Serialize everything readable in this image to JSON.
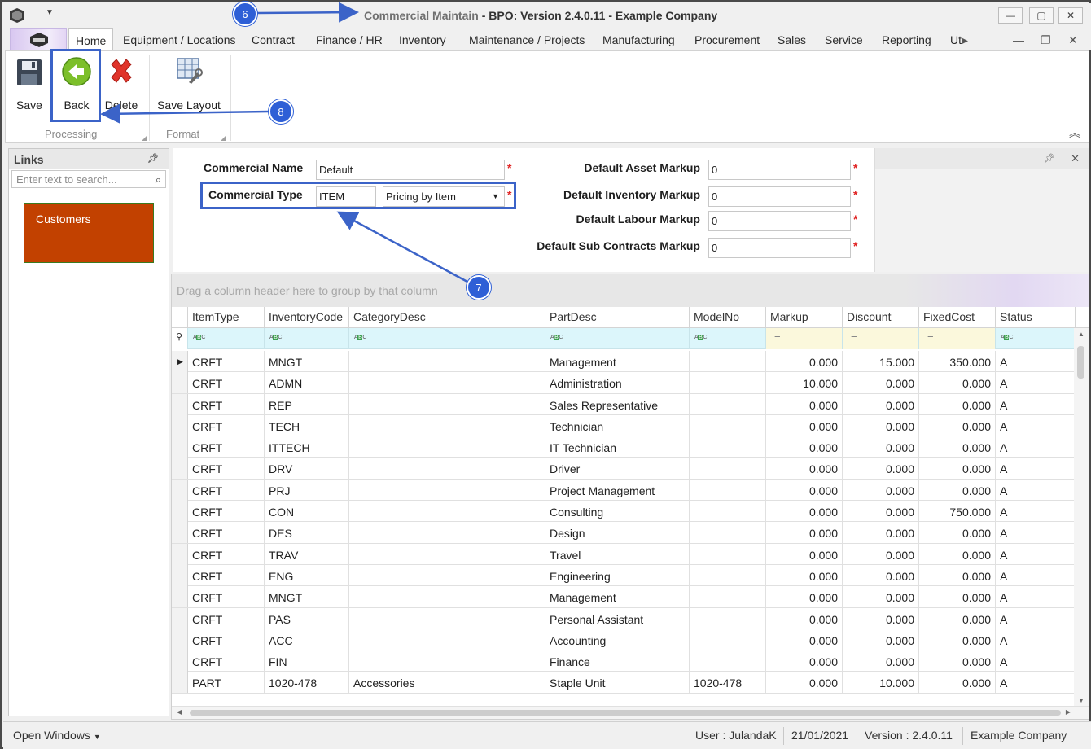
{
  "window": {
    "title_dim": "Commercial Maintain",
    "title_main": " - BPO: Version 2.4.0.11 - Example Company",
    "controls": [
      "—",
      "▢",
      "✕"
    ]
  },
  "ribbon_tabs": [
    "Home",
    "Equipment / Locations",
    "Contract",
    "Finance / HR",
    "Inventory",
    "Maintenance / Projects",
    "Manufacturing",
    "Procurement",
    "Sales",
    "Service",
    "Reporting",
    "Ut"
  ],
  "ribbon": {
    "buttons": {
      "save": "Save",
      "back": "Back",
      "delete": "Delete",
      "save_layout": "Save Layout"
    },
    "groups": {
      "processing": "Processing",
      "format": "Format"
    }
  },
  "links": {
    "title": "Links",
    "search_placeholder": "Enter text to search...",
    "tile": "Customers"
  },
  "form": {
    "commercial_name_label": "Commercial Name",
    "commercial_name_value": "Default",
    "commercial_type_label": "Commercial Type",
    "commercial_type_value": "ITEM",
    "commercial_type_select": "Pricing by Item",
    "asset_markup_label": "Default Asset Markup",
    "asset_markup_value": "0",
    "inventory_markup_label": "Default Inventory Markup",
    "inventory_markup_value": "0",
    "labour_markup_label": "Default Labour Markup",
    "labour_markup_value": "0",
    "subcontracts_markup_label": "Default Sub Contracts Markup",
    "subcontracts_markup_value": "0",
    "required_mark": "*"
  },
  "grid": {
    "group_hint": "Drag a column header here to group by that column",
    "columns": [
      "ItemType",
      "InventoryCode",
      "CategoryDesc",
      "PartDesc",
      "ModelNo",
      "Markup",
      "Discount",
      "FixedCost",
      "Status"
    ],
    "rows": [
      [
        "CRFT",
        "MNGT",
        "",
        "Management",
        "",
        "0.000",
        "15.000",
        "350.000",
        "A"
      ],
      [
        "CRFT",
        "ADMN",
        "",
        "Administration",
        "",
        "10.000",
        "0.000",
        "0.000",
        "A"
      ],
      [
        "CRFT",
        "REP",
        "",
        "Sales Representative",
        "",
        "0.000",
        "0.000",
        "0.000",
        "A"
      ],
      [
        "CRFT",
        "TECH",
        "",
        "Technician",
        "",
        "0.000",
        "0.000",
        "0.000",
        "A"
      ],
      [
        "CRFT",
        "ITTECH",
        "",
        "IT Technician",
        "",
        "0.000",
        "0.000",
        "0.000",
        "A"
      ],
      [
        "CRFT",
        "DRV",
        "",
        "Driver",
        "",
        "0.000",
        "0.000",
        "0.000",
        "A"
      ],
      [
        "CRFT",
        "PRJ",
        "",
        "Project Management",
        "",
        "0.000",
        "0.000",
        "0.000",
        "A"
      ],
      [
        "CRFT",
        "CON",
        "",
        "Consulting",
        "",
        "0.000",
        "0.000",
        "750.000",
        "A"
      ],
      [
        "CRFT",
        "DES",
        "",
        "Design",
        "",
        "0.000",
        "0.000",
        "0.000",
        "A"
      ],
      [
        "CRFT",
        "TRAV",
        "",
        "Travel",
        "",
        "0.000",
        "0.000",
        "0.000",
        "A"
      ],
      [
        "CRFT",
        "ENG",
        "",
        "Engineering",
        "",
        "0.000",
        "0.000",
        "0.000",
        "A"
      ],
      [
        "CRFT",
        "MNGT",
        "",
        "Management",
        "",
        "0.000",
        "0.000",
        "0.000",
        "A"
      ],
      [
        "CRFT",
        "PAS",
        "",
        "Personal Assistant",
        "",
        "0.000",
        "0.000",
        "0.000",
        "A"
      ],
      [
        "CRFT",
        "ACC",
        "",
        "Accounting",
        "",
        "0.000",
        "0.000",
        "0.000",
        "A"
      ],
      [
        "CRFT",
        "FIN",
        "",
        "Finance",
        "",
        "0.000",
        "0.000",
        "0.000",
        "A"
      ],
      [
        "PART",
        "1020-478",
        "Accessories",
        "Staple Unit",
        "1020-478",
        "0.000",
        "10.000",
        "0.000",
        "A"
      ]
    ]
  },
  "statusbar": {
    "open_windows": "Open Windows",
    "user": "User : JulandaK",
    "date": "21/01/2021",
    "version": "Version : 2.4.0.11",
    "company": "Example Company"
  },
  "callouts": [
    "6",
    "7",
    "8"
  ],
  "colors": {
    "accent": "#2e5fd6",
    "tile": "#c24100",
    "required": "#e02020",
    "autofilter": "#dcf6fb"
  }
}
